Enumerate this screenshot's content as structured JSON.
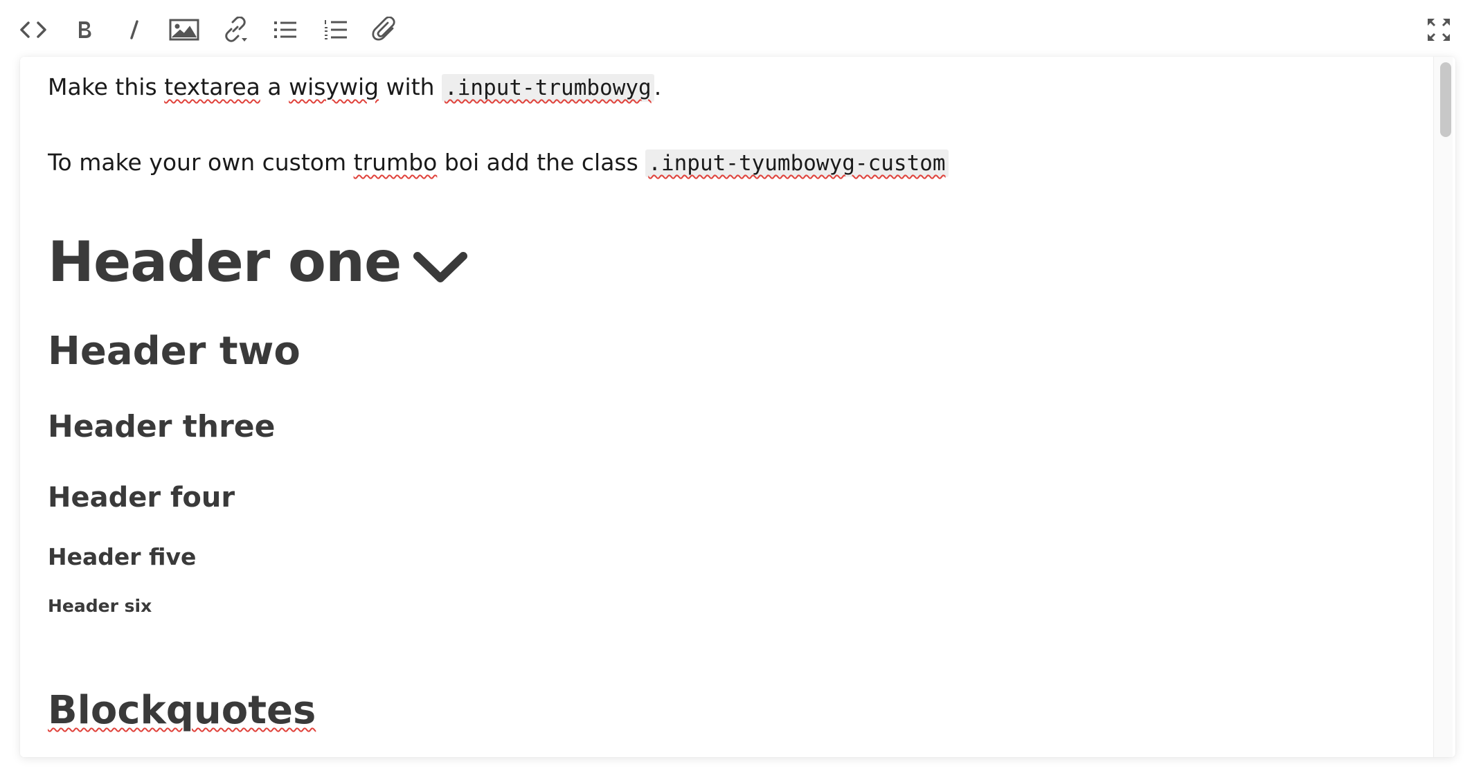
{
  "toolbar": {
    "buttons": [
      {
        "name": "view-html",
        "label": "<>"
      },
      {
        "name": "bold",
        "label": "B"
      },
      {
        "name": "italic",
        "label": "I"
      },
      {
        "name": "insert-image",
        "label": ""
      },
      {
        "name": "insert-link",
        "label": ""
      },
      {
        "name": "unordered-list",
        "label": ""
      },
      {
        "name": "ordered-list",
        "label": ""
      },
      {
        "name": "attachment",
        "label": ""
      },
      {
        "name": "fullscreen",
        "label": ""
      }
    ]
  },
  "content": {
    "p1_prefix": "Make this ",
    "p1_word1": "textarea",
    "p1_mid": " a ",
    "p1_word2": "wisywig",
    "p1_with": " with ",
    "p1_code": ".input-trumbowyg",
    "p1_end": ".",
    "p2_prefix": "To make your own custom ",
    "p2_word": "trumbo",
    "p2_mid": " boi add the class ",
    "p2_code": ".input-tyumbowyg-custom",
    "h1": "Header one",
    "h2": "Header two",
    "h3": "Header three",
    "h4": "Header four",
    "h5": "Header five",
    "h6": "Header six",
    "blockquotes": "Blockquotes"
  },
  "colors": {
    "icon": "#555555",
    "heading": "#3a3a3a",
    "spellcheck": "#e0413a",
    "code_bg": "#eeeeee"
  }
}
